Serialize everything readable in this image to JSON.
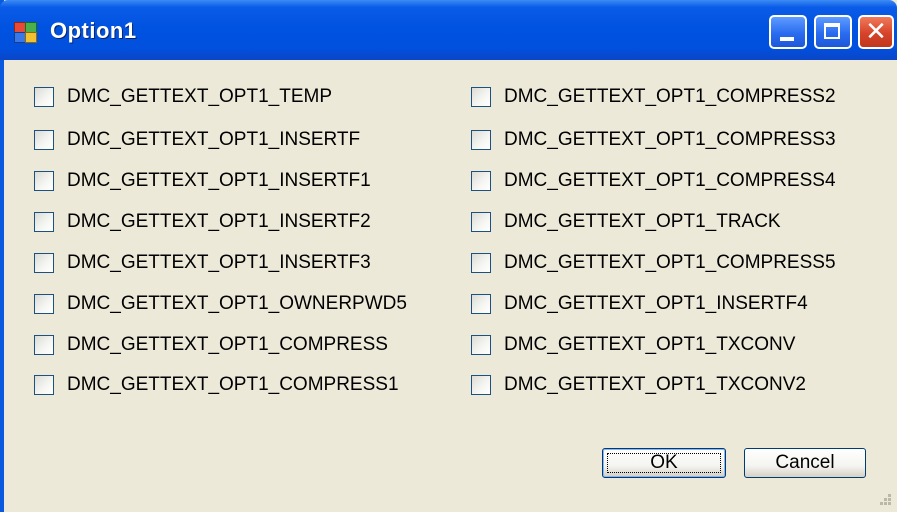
{
  "window": {
    "title": "Option1"
  },
  "title_buttons": {
    "minimize": "minimize",
    "maximize": "maximize",
    "close": "✕"
  },
  "options": {
    "left": [
      "DMC_GETTEXT_OPT1_TEMP",
      "DMC_GETTEXT_OPT1_INSERTF",
      "DMC_GETTEXT_OPT1_INSERTF1",
      "DMC_GETTEXT_OPT1_INSERTF2",
      "DMC_GETTEXT_OPT1_INSERTF3",
      "DMC_GETTEXT_OPT1_OWNERPWD5",
      "DMC_GETTEXT_OPT1_COMPRESS",
      "DMC_GETTEXT_OPT1_COMPRESS1"
    ],
    "right": [
      "DMC_GETTEXT_OPT1_COMPRESS2",
      "DMC_GETTEXT_OPT1_COMPRESS3",
      "DMC_GETTEXT_OPT1_COMPRESS4",
      "DMC_GETTEXT_OPT1_TRACK",
      "DMC_GETTEXT_OPT1_COMPRESS5",
      "DMC_GETTEXT_OPT1_INSERTF4",
      "DMC_GETTEXT_OPT1_TXCONV",
      "DMC_GETTEXT_OPT1_TXCONV2"
    ]
  },
  "buttons": {
    "ok": "OK",
    "cancel": "Cancel"
  },
  "colors": {
    "titlebar": "#0052E0",
    "dialog_bg": "#ECE9D8",
    "close_button": "#D6432A"
  }
}
